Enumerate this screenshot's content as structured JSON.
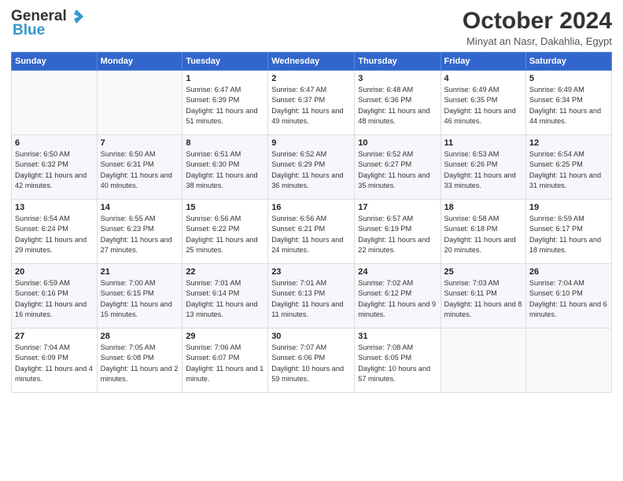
{
  "header": {
    "logo_general": "General",
    "logo_blue": "Blue",
    "month_title": "October 2024",
    "subtitle": "Minyat an Nasr, Dakahlia, Egypt"
  },
  "weekdays": [
    "Sunday",
    "Monday",
    "Tuesday",
    "Wednesday",
    "Thursday",
    "Friday",
    "Saturday"
  ],
  "weeks": [
    [
      {
        "day": "",
        "info": ""
      },
      {
        "day": "",
        "info": ""
      },
      {
        "day": "1",
        "info": "Sunrise: 6:47 AM\nSunset: 6:39 PM\nDaylight: 11 hours and 51 minutes."
      },
      {
        "day": "2",
        "info": "Sunrise: 6:47 AM\nSunset: 6:37 PM\nDaylight: 11 hours and 49 minutes."
      },
      {
        "day": "3",
        "info": "Sunrise: 6:48 AM\nSunset: 6:36 PM\nDaylight: 11 hours and 48 minutes."
      },
      {
        "day": "4",
        "info": "Sunrise: 6:49 AM\nSunset: 6:35 PM\nDaylight: 11 hours and 46 minutes."
      },
      {
        "day": "5",
        "info": "Sunrise: 6:49 AM\nSunset: 6:34 PM\nDaylight: 11 hours and 44 minutes."
      }
    ],
    [
      {
        "day": "6",
        "info": "Sunrise: 6:50 AM\nSunset: 6:32 PM\nDaylight: 11 hours and 42 minutes."
      },
      {
        "day": "7",
        "info": "Sunrise: 6:50 AM\nSunset: 6:31 PM\nDaylight: 11 hours and 40 minutes."
      },
      {
        "day": "8",
        "info": "Sunrise: 6:51 AM\nSunset: 6:30 PM\nDaylight: 11 hours and 38 minutes."
      },
      {
        "day": "9",
        "info": "Sunrise: 6:52 AM\nSunset: 6:29 PM\nDaylight: 11 hours and 36 minutes."
      },
      {
        "day": "10",
        "info": "Sunrise: 6:52 AM\nSunset: 6:27 PM\nDaylight: 11 hours and 35 minutes."
      },
      {
        "day": "11",
        "info": "Sunrise: 6:53 AM\nSunset: 6:26 PM\nDaylight: 11 hours and 33 minutes."
      },
      {
        "day": "12",
        "info": "Sunrise: 6:54 AM\nSunset: 6:25 PM\nDaylight: 11 hours and 31 minutes."
      }
    ],
    [
      {
        "day": "13",
        "info": "Sunrise: 6:54 AM\nSunset: 6:24 PM\nDaylight: 11 hours and 29 minutes."
      },
      {
        "day": "14",
        "info": "Sunrise: 6:55 AM\nSunset: 6:23 PM\nDaylight: 11 hours and 27 minutes."
      },
      {
        "day": "15",
        "info": "Sunrise: 6:56 AM\nSunset: 6:22 PM\nDaylight: 11 hours and 25 minutes."
      },
      {
        "day": "16",
        "info": "Sunrise: 6:56 AM\nSunset: 6:21 PM\nDaylight: 11 hours and 24 minutes."
      },
      {
        "day": "17",
        "info": "Sunrise: 6:57 AM\nSunset: 6:19 PM\nDaylight: 11 hours and 22 minutes."
      },
      {
        "day": "18",
        "info": "Sunrise: 6:58 AM\nSunset: 6:18 PM\nDaylight: 11 hours and 20 minutes."
      },
      {
        "day": "19",
        "info": "Sunrise: 6:59 AM\nSunset: 6:17 PM\nDaylight: 11 hours and 18 minutes."
      }
    ],
    [
      {
        "day": "20",
        "info": "Sunrise: 6:59 AM\nSunset: 6:16 PM\nDaylight: 11 hours and 16 minutes."
      },
      {
        "day": "21",
        "info": "Sunrise: 7:00 AM\nSunset: 6:15 PM\nDaylight: 11 hours and 15 minutes."
      },
      {
        "day": "22",
        "info": "Sunrise: 7:01 AM\nSunset: 6:14 PM\nDaylight: 11 hours and 13 minutes."
      },
      {
        "day": "23",
        "info": "Sunrise: 7:01 AM\nSunset: 6:13 PM\nDaylight: 11 hours and 11 minutes."
      },
      {
        "day": "24",
        "info": "Sunrise: 7:02 AM\nSunset: 6:12 PM\nDaylight: 11 hours and 9 minutes."
      },
      {
        "day": "25",
        "info": "Sunrise: 7:03 AM\nSunset: 6:11 PM\nDaylight: 11 hours and 8 minutes."
      },
      {
        "day": "26",
        "info": "Sunrise: 7:04 AM\nSunset: 6:10 PM\nDaylight: 11 hours and 6 minutes."
      }
    ],
    [
      {
        "day": "27",
        "info": "Sunrise: 7:04 AM\nSunset: 6:09 PM\nDaylight: 11 hours and 4 minutes."
      },
      {
        "day": "28",
        "info": "Sunrise: 7:05 AM\nSunset: 6:08 PM\nDaylight: 11 hours and 2 minutes."
      },
      {
        "day": "29",
        "info": "Sunrise: 7:06 AM\nSunset: 6:07 PM\nDaylight: 11 hours and 1 minute."
      },
      {
        "day": "30",
        "info": "Sunrise: 7:07 AM\nSunset: 6:06 PM\nDaylight: 10 hours and 59 minutes."
      },
      {
        "day": "31",
        "info": "Sunrise: 7:08 AM\nSunset: 6:05 PM\nDaylight: 10 hours and 57 minutes."
      },
      {
        "day": "",
        "info": ""
      },
      {
        "day": "",
        "info": ""
      }
    ]
  ]
}
